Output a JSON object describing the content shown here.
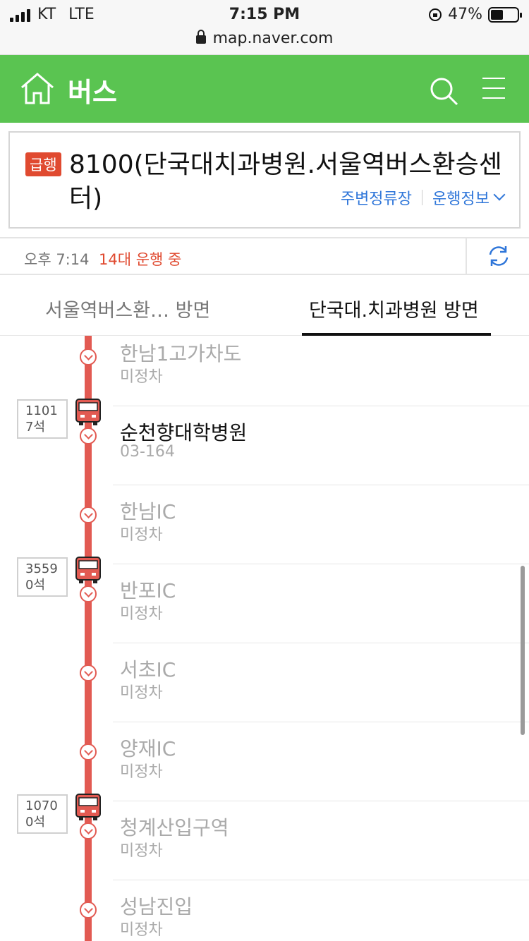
{
  "status_bar": {
    "carrier": "KT",
    "network": "LTE",
    "time": "7:15 PM",
    "battery": "47%"
  },
  "url": "map.naver.com",
  "header": {
    "title": "버스"
  },
  "route": {
    "badge": "급행",
    "name": "8100(단국대치과병원.서울역버스환승센터)",
    "links": [
      "주변정류장",
      "운행정보"
    ]
  },
  "info": {
    "time": "오후 7:14",
    "running": "14대 운행 중"
  },
  "tabs": [
    {
      "label": "서울역버스환… 방면",
      "active": false
    },
    {
      "label": "단국대.치과병원 방면",
      "active": true
    }
  ],
  "stops": [
    {
      "name": "한남1고가차도",
      "sub": "미정차",
      "current": false
    },
    {
      "name": "순천향대학병원",
      "sub": "03-164",
      "current": true
    },
    {
      "name": "한남IC",
      "sub": "미정차",
      "current": false
    },
    {
      "name": "반포IC",
      "sub": "미정차",
      "current": false
    },
    {
      "name": "서초IC",
      "sub": "미정차",
      "current": false
    },
    {
      "name": "양재IC",
      "sub": "미정차",
      "current": false
    },
    {
      "name": "청계산입구역",
      "sub": "미정차",
      "current": false
    },
    {
      "name": "성남진입",
      "sub": "미정차",
      "current": false
    }
  ],
  "buses": [
    {
      "number": "1101",
      "seats": "7석"
    },
    {
      "number": "3559",
      "seats": "0석"
    },
    {
      "number": "1070",
      "seats": "0석"
    }
  ],
  "colors": {
    "header": "#5ac451",
    "route_line": "#e25a52",
    "link": "#2f76d9",
    "badge": "#e04a30"
  }
}
